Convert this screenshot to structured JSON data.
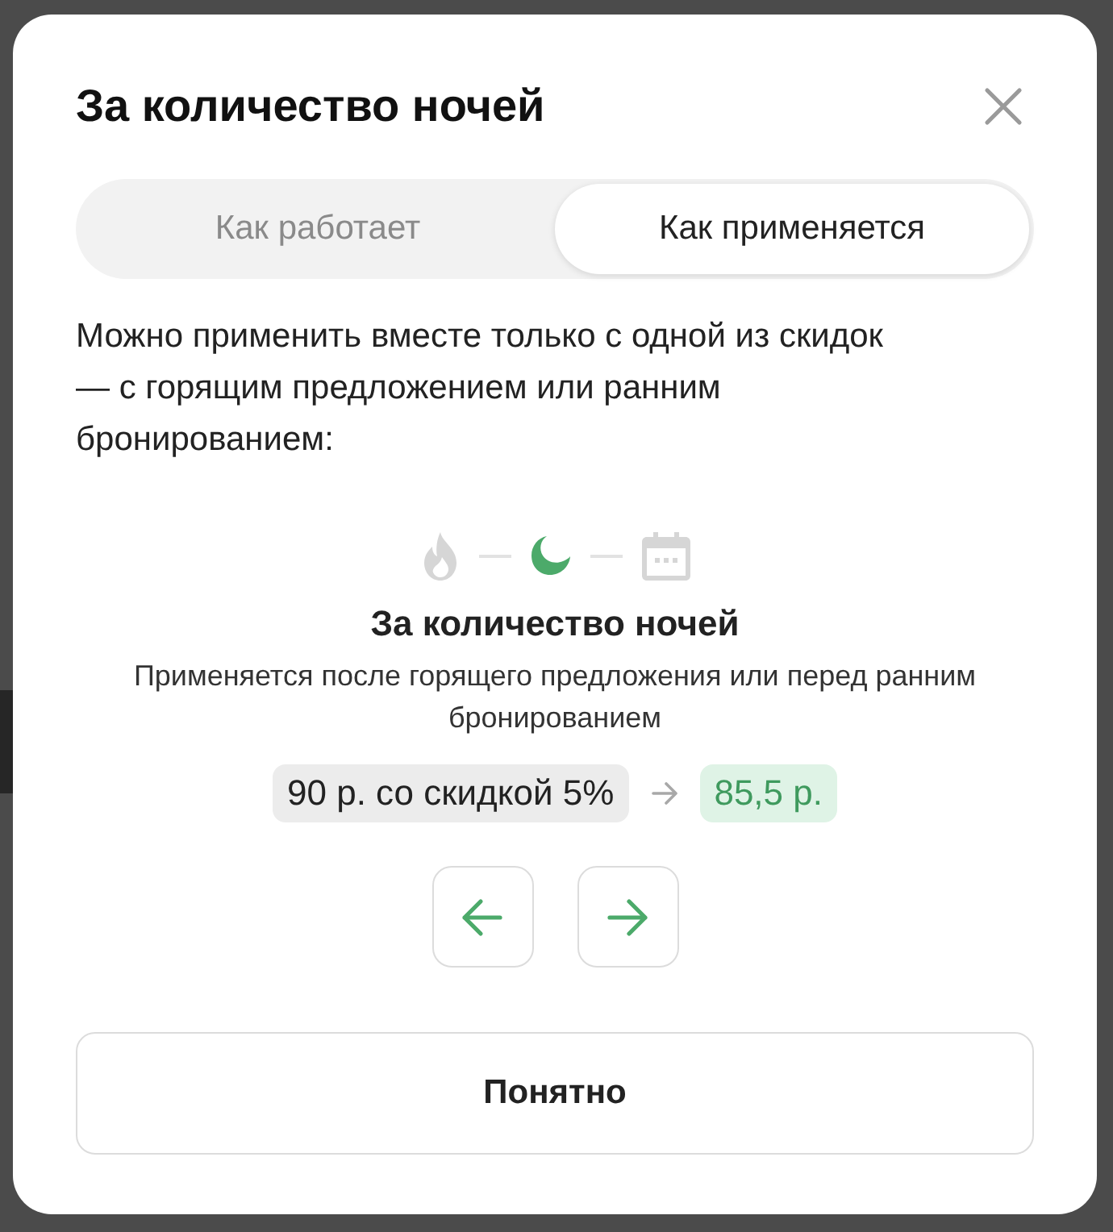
{
  "dialog": {
    "title": "За количество ночей"
  },
  "tabs": [
    {
      "label": "Как работает",
      "selected": false
    },
    {
      "label": "Как применяется",
      "selected": true
    }
  ],
  "description": "Можно применить вместе только с одной из скидок — с горящим предложением или ранним бронированием:",
  "steps": [
    {
      "kind": "flame",
      "selected": false
    },
    {
      "kind": "moon",
      "selected": true
    },
    {
      "kind": "calendar",
      "selected": false
    }
  ],
  "step": {
    "title": "За количество ночей",
    "text": "Применяется после горящего предложения или перед ранним бронированием"
  },
  "price": {
    "before": "90 р. со скидкой 5%",
    "after": "85,5 р."
  },
  "confirm_button": "Понятно"
}
